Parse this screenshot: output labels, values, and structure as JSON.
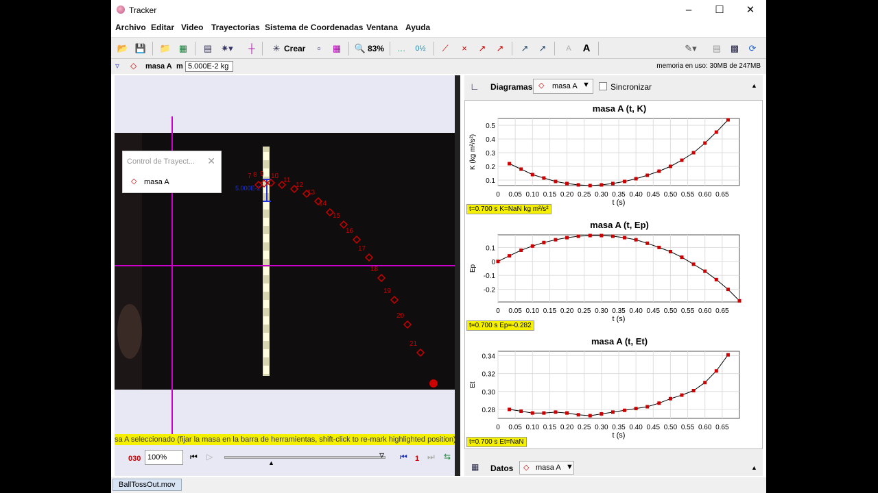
{
  "window": {
    "title": "Tracker"
  },
  "menu": [
    "Archivo",
    "Editar",
    "Video",
    "Trayectorias",
    "Sistema de Coordenadas",
    "Ventana",
    "Ayuda"
  ],
  "toolbar": {
    "create_label": "Crear",
    "zoom": "83%",
    "font_label": "A"
  },
  "trackbar": {
    "track_name": "masa A",
    "mass_label": "m",
    "mass_value": "5.000E-2 kg",
    "memory": "memoria en uso: 30MB de 247MB"
  },
  "track_control": {
    "title": "Control de Trayect...",
    "item": "masa A"
  },
  "video": {
    "point_labels": [
      "7",
      "8",
      "9",
      "10",
      "11",
      "12",
      "13",
      "14",
      "15",
      "16",
      "17",
      "18",
      "19",
      "20",
      "21"
    ],
    "scale_label": "5.000E-2"
  },
  "status_text": "sa A seleccionado (fijar la masa en la barra de herramientas, shift-click to re-mark highlighted position)",
  "player": {
    "frame": "030",
    "zoom": "100%",
    "step": "1"
  },
  "plots_header": {
    "tab_label": "Diagramas",
    "track": "masa A",
    "sync_label": "Sincronizar"
  },
  "plots": [
    {
      "title": "masa A (t, K)",
      "ylabel": "K (kg m²/s²)",
      "xlabel": "t (s)",
      "readout": "t=0.700 s  K=NaN kg m²/s²",
      "yticks": [
        "0.5",
        "0.4",
        "0.3",
        "0.2",
        "0.1"
      ]
    },
    {
      "title": "masa A (t, Ep)",
      "ylabel": "Ep",
      "xlabel": "t (s)",
      "readout": "t=0.700 s  Ep=-0.282",
      "yticks": [
        "0.1",
        "0",
        "-0.1",
        "-0.2"
      ]
    },
    {
      "title": "masa A (t, Et)",
      "ylabel": "Et",
      "xlabel": "t (s)",
      "readout": "t=0.700 s  Et=NaN",
      "yticks": [
        "0.34",
        "0.32",
        "0.30",
        "0.28"
      ]
    }
  ],
  "xticks": [
    "0",
    "0.05",
    "0.10",
    "0.15",
    "0.20",
    "0.25",
    "0.30",
    "0.35",
    "0.40",
    "0.45",
    "0.50",
    "0.55",
    "0.60",
    "0.65"
  ],
  "chart_data": [
    {
      "type": "line",
      "title": "masa A (t, K)",
      "xlabel": "t (s)",
      "ylabel": "K (kg m²/s²)",
      "xlim": [
        0,
        0.7
      ],
      "ylim": [
        0.06,
        0.55
      ],
      "x": [
        0.033,
        0.067,
        0.1,
        0.133,
        0.167,
        0.2,
        0.233,
        0.267,
        0.3,
        0.333,
        0.367,
        0.4,
        0.433,
        0.467,
        0.5,
        0.533,
        0.567,
        0.6,
        0.633,
        0.667
      ],
      "y": [
        0.22,
        0.18,
        0.14,
        0.115,
        0.09,
        0.075,
        0.065,
        0.06,
        0.065,
        0.075,
        0.09,
        0.11,
        0.135,
        0.165,
        0.2,
        0.245,
        0.3,
        0.37,
        0.45,
        0.54
      ]
    },
    {
      "type": "line",
      "title": "masa A (t, Ep)",
      "xlabel": "t (s)",
      "ylabel": "Ep",
      "xlim": [
        0,
        0.7
      ],
      "ylim": [
        -0.29,
        0.19
      ],
      "x": [
        0.0,
        0.033,
        0.067,
        0.1,
        0.133,
        0.167,
        0.2,
        0.233,
        0.267,
        0.3,
        0.333,
        0.367,
        0.4,
        0.433,
        0.467,
        0.5,
        0.533,
        0.567,
        0.6,
        0.633,
        0.667,
        0.7
      ],
      "y": [
        0.0,
        0.04,
        0.08,
        0.11,
        0.135,
        0.155,
        0.17,
        0.18,
        0.185,
        0.185,
        0.18,
        0.17,
        0.155,
        0.13,
        0.1,
        0.07,
        0.03,
        -0.02,
        -0.07,
        -0.13,
        -0.2,
        -0.282
      ]
    },
    {
      "type": "line",
      "title": "masa A (t, Et)",
      "xlabel": "t (s)",
      "ylabel": "Et",
      "xlim": [
        0,
        0.7
      ],
      "ylim": [
        0.27,
        0.345
      ],
      "x": [
        0.033,
        0.067,
        0.1,
        0.133,
        0.167,
        0.2,
        0.233,
        0.267,
        0.3,
        0.333,
        0.367,
        0.4,
        0.433,
        0.467,
        0.5,
        0.533,
        0.567,
        0.6,
        0.633,
        0.667
      ],
      "y": [
        0.28,
        0.278,
        0.276,
        0.276,
        0.277,
        0.276,
        0.274,
        0.273,
        0.275,
        0.277,
        0.279,
        0.281,
        0.283,
        0.287,
        0.292,
        0.296,
        0.301,
        0.31,
        0.323,
        0.341
      ]
    }
  ],
  "datos_bar": {
    "label": "Datos",
    "track": "masa A"
  },
  "file_tab": "BallTossOut.mov",
  "colors": {
    "accent": "#cc0000",
    "axis": "#cc00cc",
    "readout_bg": "#f4f000"
  }
}
